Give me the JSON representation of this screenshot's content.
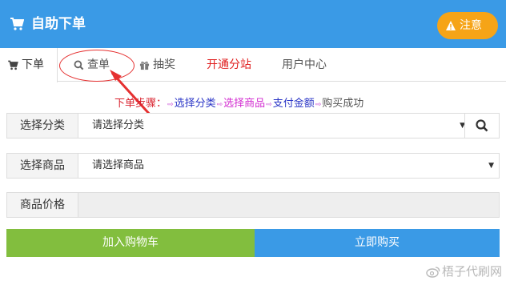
{
  "header": {
    "title": "自助下单",
    "cart_icon": "shopping-cart-icon",
    "notice_label": "注意",
    "notice_icon": "warning-icon",
    "bg_color": "#3a9ae6",
    "notice_color": "#f6a417"
  },
  "tabs": [
    {
      "label": "下单",
      "icon": "shopping-cart-icon",
      "active": true
    },
    {
      "label": "查单",
      "icon": "search-icon"
    },
    {
      "label": "抽奖",
      "icon": "gift-icon"
    },
    {
      "label": "开通分站",
      "color": "#e02020"
    },
    {
      "label": "用户中心"
    }
  ],
  "steps": {
    "prefix": "下单步骤：",
    "items": [
      "选择分类",
      "选择商品",
      "支付金额",
      "购买成功"
    ]
  },
  "form": {
    "category": {
      "label": "选择分类",
      "value": "请选择分类"
    },
    "product": {
      "label": "选择商品",
      "value": "请选择商品"
    },
    "price": {
      "label": "商品价格",
      "value": ""
    }
  },
  "actions": {
    "add_cart": "加入购物车",
    "buy_now": "立即购买",
    "add_cart_color": "#82be3e",
    "buy_now_color": "#3a9ae6"
  },
  "watermark": {
    "text": "梧子代刷网",
    "icon": "weibo-icon"
  }
}
